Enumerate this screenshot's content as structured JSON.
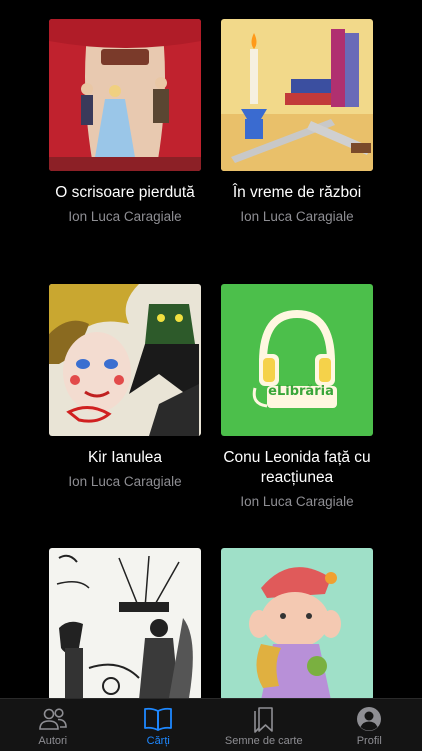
{
  "books": [
    {
      "title": "O scrisoare pierdută",
      "author": "Ion Luca Caragiale",
      "cover_icon": "theater-stage-illustration"
    },
    {
      "title": "În vreme de război",
      "author": "Ion Luca Caragiale",
      "cover_icon": "candle-books-knives-illustration"
    },
    {
      "title": "Kir Ianulea",
      "author": "Ion Luca Caragiale",
      "cover_icon": "face-devil-illustration"
    },
    {
      "title": "Conu Leonida față cu reacțiunea",
      "author": "Ion Luca Caragiale",
      "cover_icon": "headphones-elibraria-logo"
    },
    {
      "title": "",
      "author": "",
      "cover_icon": "ink-sketch-illustration"
    },
    {
      "title": "",
      "author": "",
      "cover_icon": "character-drawing-illustration"
    }
  ],
  "cover_logo_text": "eLibrăria",
  "tabbar": {
    "tabs": [
      {
        "label": "Autori",
        "icon": "people-icon",
        "active": false
      },
      {
        "label": "Cărți",
        "icon": "book-icon",
        "active": true
      },
      {
        "label": "Semne de carte",
        "icon": "bookmarks-icon",
        "active": false
      },
      {
        "label": "Profil",
        "icon": "profile-icon",
        "active": false
      }
    ]
  },
  "colors": {
    "background": "#000000",
    "accent": "#1e88ff",
    "muted": "#8e8e93",
    "elibraria_green": "#4cbf4b"
  }
}
